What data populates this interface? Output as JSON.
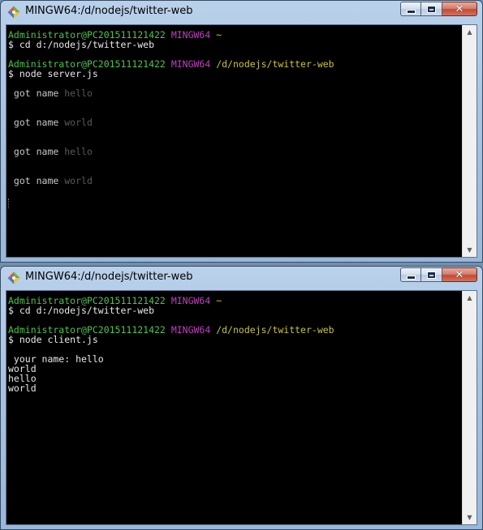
{
  "windows": {
    "top": {
      "title": "MINGW64:/d/nodejs/twitter-web",
      "lines": [
        {
          "parts": [
            {
              "t": "Administrator@PC201511121422",
              "c": "green"
            },
            {
              "t": " "
            },
            {
              "t": "MINGW64",
              "c": "magenta"
            },
            {
              "t": " ~",
              "c": "yellow"
            }
          ]
        },
        {
          "parts": [
            {
              "t": "$ cd d:/nodejs/twitter-web",
              "c": "white"
            }
          ]
        },
        {
          "blank": true
        },
        {
          "parts": [
            {
              "t": "Administrator@PC201511121422",
              "c": "green"
            },
            {
              "t": " "
            },
            {
              "t": "MINGW64",
              "c": "magenta"
            },
            {
              "t": " /d/nodejs/twitter-web",
              "c": "yellow"
            }
          ]
        },
        {
          "parts": [
            {
              "t": "$ node server.js",
              "c": "white"
            }
          ]
        },
        {
          "blank": true
        },
        {
          "parts": [
            {
              "t": " got name ",
              "c": "gray"
            },
            {
              "t": "hello",
              "c": "dim"
            }
          ]
        },
        {
          "blank": true
        },
        {
          "blank": true
        },
        {
          "parts": [
            {
              "t": " got name ",
              "c": "gray"
            },
            {
              "t": "world",
              "c": "dim"
            }
          ]
        },
        {
          "blank": true
        },
        {
          "blank": true
        },
        {
          "parts": [
            {
              "t": " got name ",
              "c": "gray"
            },
            {
              "t": "hello",
              "c": "dim"
            }
          ]
        },
        {
          "blank": true
        },
        {
          "blank": true
        },
        {
          "parts": [
            {
              "t": " got name ",
              "c": "gray"
            },
            {
              "t": "world",
              "c": "dim"
            }
          ]
        }
      ]
    },
    "bottom": {
      "title": "MINGW64:/d/nodejs/twitter-web",
      "lines": [
        {
          "parts": [
            {
              "t": "Administrator@PC201511121422",
              "c": "green"
            },
            {
              "t": " "
            },
            {
              "t": "MINGW64",
              "c": "magenta"
            },
            {
              "t": " ~",
              "c": "yellow"
            }
          ]
        },
        {
          "parts": [
            {
              "t": "$ cd d:/nodejs/twitter-web",
              "c": "white"
            }
          ]
        },
        {
          "blank": true
        },
        {
          "parts": [
            {
              "t": "Administrator@PC201511121422",
              "c": "green"
            },
            {
              "t": " "
            },
            {
              "t": "MINGW64",
              "c": "magenta"
            },
            {
              "t": " /d/nodejs/twitter-web",
              "c": "yellow"
            }
          ]
        },
        {
          "parts": [
            {
              "t": "$ node client.js",
              "c": "white"
            }
          ]
        },
        {
          "blank": true
        },
        {
          "parts": [
            {
              "t": " your name: hello",
              "c": "white"
            }
          ]
        },
        {
          "parts": [
            {
              "t": "world",
              "c": "white"
            }
          ]
        },
        {
          "parts": [
            {
              "t": "hello",
              "c": "white"
            }
          ]
        },
        {
          "parts": [
            {
              "t": "world",
              "c": "white"
            }
          ]
        }
      ]
    }
  },
  "icons": {
    "app": "git-bash-diamond-icon",
    "minimize": "minimize-icon",
    "maximize": "maximize-icon",
    "close": "close-icon",
    "scroll_up": "scroll-up-arrow-icon",
    "scroll_down": "scroll-down-arrow-icon"
  },
  "glyphs": {
    "close": "✕",
    "scroll_up": "▲",
    "scroll_down": "▼"
  },
  "colors": {
    "prompt_user": "#4ec44e",
    "prompt_shell": "#c040c0",
    "prompt_path": "#c8c43a",
    "terminal_bg": "#000000",
    "close_button": "#c24a35"
  }
}
